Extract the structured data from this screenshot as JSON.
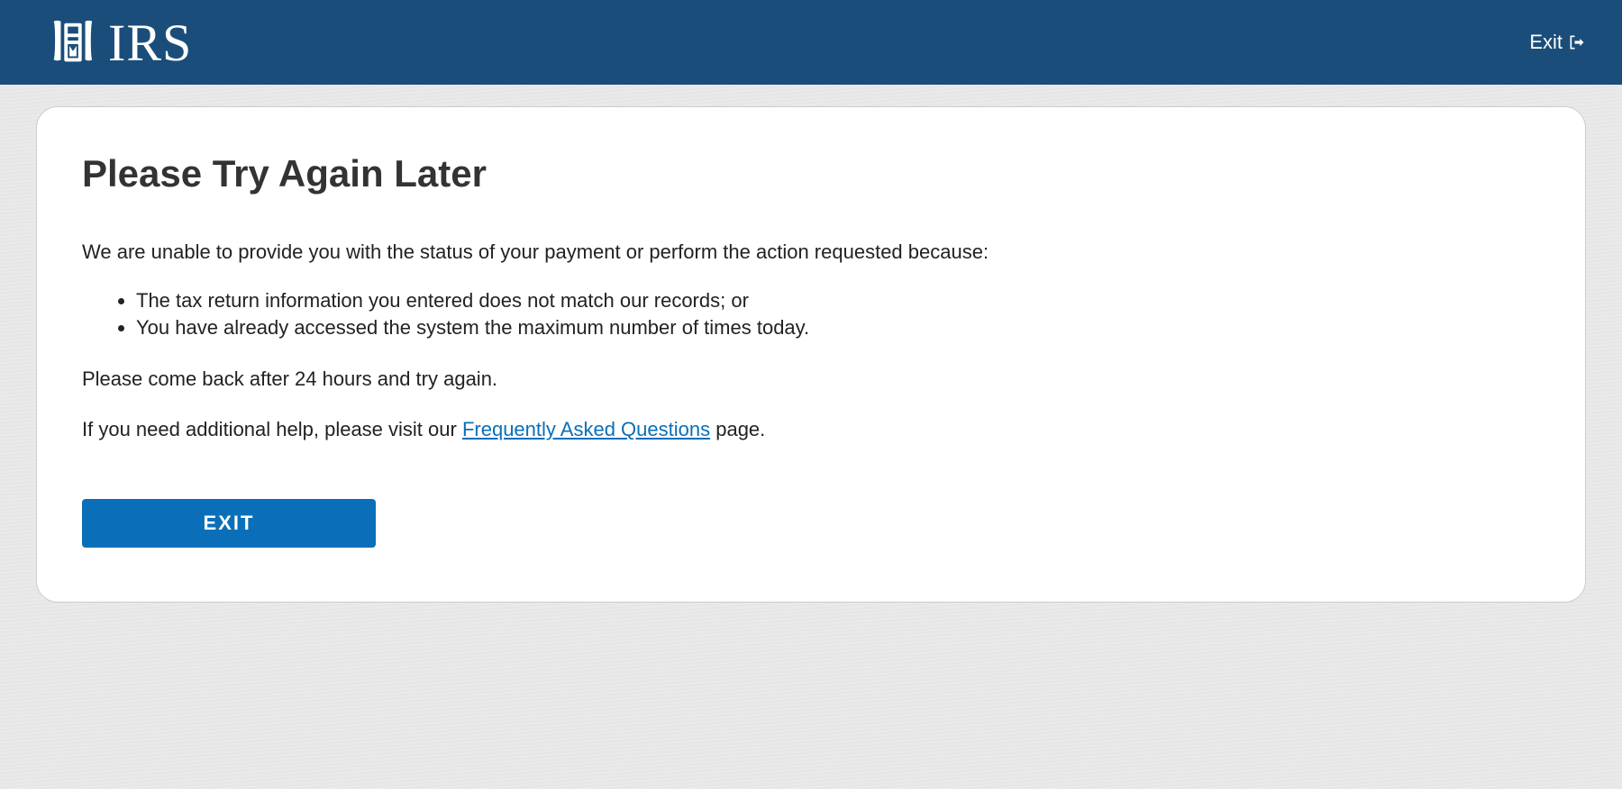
{
  "header": {
    "logo_text": "IRS",
    "exit_label": "Exit"
  },
  "main": {
    "title": "Please Try Again Later",
    "intro": "We are unable to provide you with the status of your payment or perform the action requested because:",
    "reasons": [
      "The tax return information you entered does not match our records; or",
      "You have already accessed the system the maximum number of times today."
    ],
    "retry_text": "Please come back after 24 hours and try again.",
    "help_prefix": "If you need additional help, please visit our ",
    "faq_link_text": "Frequently Asked Questions",
    "help_suffix": " page.",
    "exit_button_label": "EXIT"
  }
}
